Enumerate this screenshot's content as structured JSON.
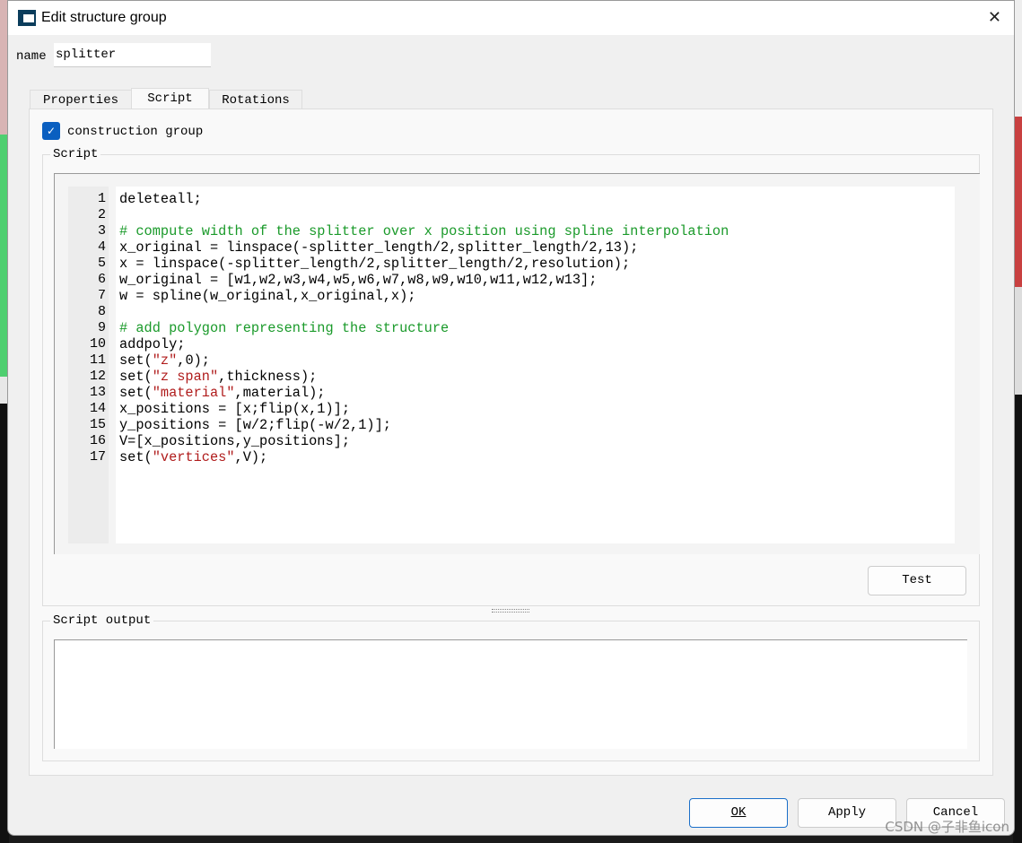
{
  "window": {
    "title": "Edit structure group",
    "close_icon": "close-icon"
  },
  "name_label": "name",
  "name_value": "splitter",
  "tabs": [
    {
      "label": "Properties"
    },
    {
      "label": "Script",
      "active": true
    },
    {
      "label": "Rotations"
    }
  ],
  "construction_group": {
    "label": "construction group",
    "checked": true
  },
  "script_group": {
    "title": "Script"
  },
  "script_lines": [
    [
      {
        "t": "deleteall;"
      }
    ],
    [],
    [
      {
        "t": "# compute width of the splitter over x position using spline interpolation",
        "k": "c"
      }
    ],
    [
      {
        "t": "x_original = linspace(-splitter_length/2,splitter_length/2,13);"
      }
    ],
    [
      {
        "t": "x = linspace(-splitter_length/2,splitter_length/2,resolution);"
      }
    ],
    [
      {
        "t": "w_original = [w1,w2,w3,w4,w5,w6,w7,w8,w9,w10,w11,w12,w13];"
      }
    ],
    [
      {
        "t": "w = spline(w_original,x_original,x);"
      }
    ],
    [],
    [
      {
        "t": "# add polygon representing the structure",
        "k": "c"
      }
    ],
    [
      {
        "t": "addpoly;"
      }
    ],
    [
      {
        "t": "set("
      },
      {
        "t": "\"z\"",
        "k": "s"
      },
      {
        "t": ",0);"
      }
    ],
    [
      {
        "t": "set("
      },
      {
        "t": "\"z span\"",
        "k": "s"
      },
      {
        "t": ",thickness);"
      }
    ],
    [
      {
        "t": "set("
      },
      {
        "t": "\"material\"",
        "k": "s"
      },
      {
        "t": ",material);"
      }
    ],
    [
      {
        "t": "x_positions = [x;flip(x,1)];"
      }
    ],
    [
      {
        "t": "y_positions = [w/2;flip(-w/2,1)];"
      }
    ],
    [
      {
        "t": "V=[x_positions,y_positions];"
      }
    ],
    [
      {
        "t": "set("
      },
      {
        "t": "\"vertices\"",
        "k": "s"
      },
      {
        "t": ",V);"
      }
    ]
  ],
  "test_button": "Test",
  "output_group": {
    "title": "Script output",
    "value": ""
  },
  "buttons": {
    "ok": "OK",
    "apply": "Apply",
    "cancel": "Cancel"
  },
  "watermark": "CSDN @子非鱼icon",
  "colors": {
    "comment": "#1a9a2a",
    "string": "#b01c1c",
    "accent": "#0a5fc0"
  }
}
